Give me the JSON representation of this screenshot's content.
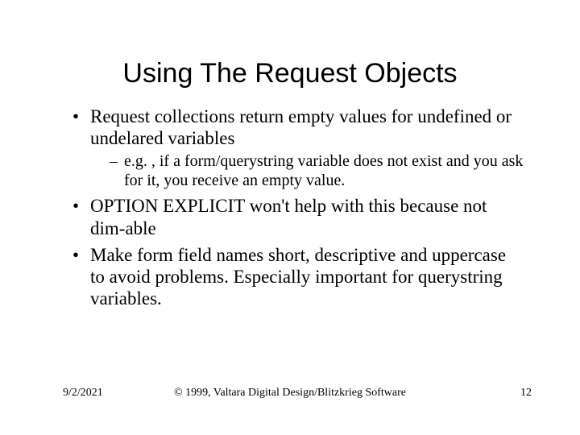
{
  "title": "Using The Request Objects",
  "bullets": {
    "b1": "Request collections return empty values for undefined or undelared variables",
    "b1_sub1": "e.g. , if a form/querystring variable does not exist and you ask for it, you receive an empty value.",
    "b2": "OPTION EXPLICIT won't help with this because not dim-able",
    "b3": "Make form field names short, descriptive and uppercase to avoid problems. Especially important for querystring variables."
  },
  "footer": {
    "date": "9/2/2021",
    "copyright": "© 1999, Valtara Digital Design/Blitzkrieg Software",
    "page": "12"
  }
}
